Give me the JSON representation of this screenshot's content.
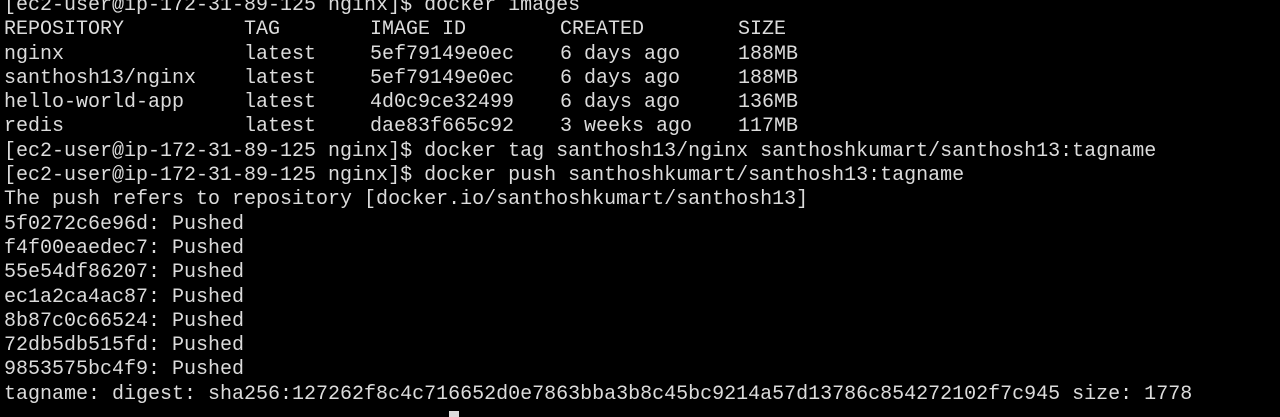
{
  "terminal": {
    "prompt": "[ec2-user@ip-172-31-89-125 nginx]$ ",
    "cmd_images": "docker images",
    "table": {
      "headers": [
        "REPOSITORY",
        "TAG",
        "IMAGE ID",
        "CREATED",
        "SIZE"
      ],
      "rows": [
        [
          "nginx",
          "latest",
          "5ef79149e0ec",
          "6 days ago",
          "188MB"
        ],
        [
          "santhosh13/nginx",
          "latest",
          "5ef79149e0ec",
          "6 days ago",
          "188MB"
        ],
        [
          "hello-world-app",
          "latest",
          "4d0c9ce32499",
          "6 days ago",
          "136MB"
        ],
        [
          "redis",
          "latest",
          "dae83f665c92",
          "3 weeks ago",
          "117MB"
        ]
      ]
    },
    "cmd_tag": "docker tag santhosh13/nginx santhoshkumart/santhosh13:tagname",
    "cmd_push": "docker push santhoshkumart/santhosh13:tagname",
    "push_refers": "The push refers to repository [docker.io/santhoshkumart/santhosh13]",
    "layers": [
      "5f0272c6e96d: Pushed",
      "f4f00eaedec7: Pushed",
      "55e54df86207: Pushed",
      "ec1a2ca4ac87: Pushed",
      "8b87c0c66524: Pushed",
      "72db5db515fd: Pushed",
      "9853575bc4f9: Pushed"
    ],
    "digest_line": "tagname: digest: sha256:127262f8c4c716652d0e7863bba3b8c45bc9214a57d13786c854272102f7c945 size: 1778"
  }
}
